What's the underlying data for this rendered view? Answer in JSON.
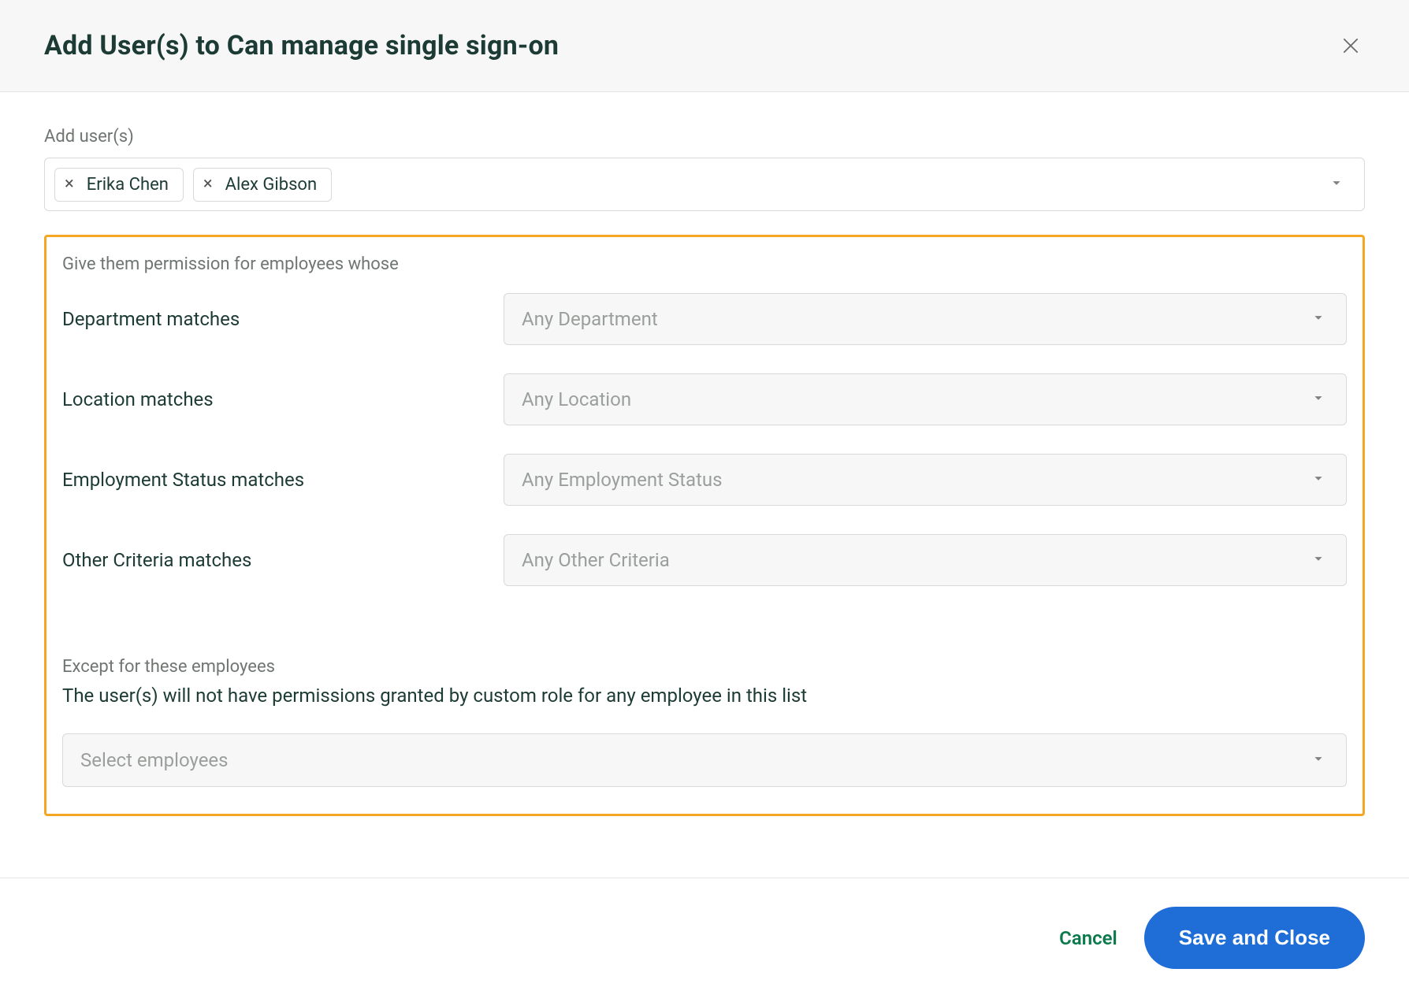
{
  "header": {
    "title": "Add User(s) to Can manage single sign-on"
  },
  "addUsers": {
    "label": "Add user(s)",
    "chips": [
      "Erika Chen",
      "Alex Gibson"
    ]
  },
  "permissions": {
    "intro": "Give them permission for employees whose",
    "rows": [
      {
        "label": "Department matches",
        "placeholder": "Any Department"
      },
      {
        "label": "Location matches",
        "placeholder": "Any Location"
      },
      {
        "label": "Employment Status matches",
        "placeholder": "Any Employment Status"
      },
      {
        "label": "Other Criteria matches",
        "placeholder": "Any Other Criteria"
      }
    ]
  },
  "except": {
    "title": "Except for these employees",
    "desc": "The user(s) will not have permissions granted by custom role for any employee in this list",
    "placeholder": "Select employees"
  },
  "footer": {
    "cancel": "Cancel",
    "save": "Save and Close"
  }
}
